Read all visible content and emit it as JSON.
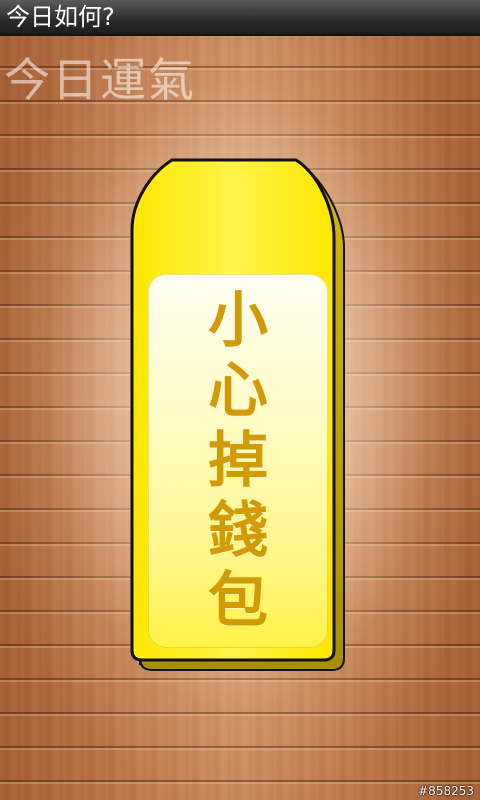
{
  "window": {
    "title": "今日如何?"
  },
  "header": {
    "label": "今日運氣"
  },
  "fortune_card": {
    "characters": [
      "小",
      "心",
      "掉",
      "錢",
      "包"
    ],
    "text_color": "#d19a07",
    "card_color": "#fff200"
  },
  "watermark": {
    "text": "#858253"
  },
  "colors": {
    "title_bar": "#2c2c2c",
    "wood": "#c27b4c"
  }
}
